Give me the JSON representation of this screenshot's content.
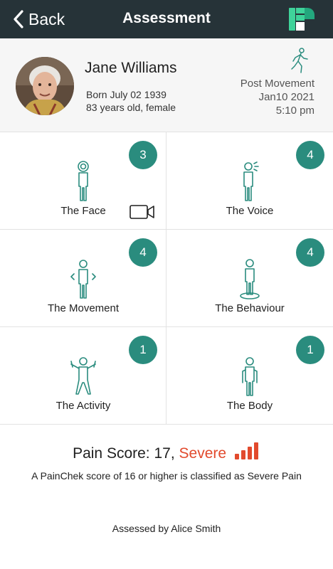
{
  "nav": {
    "back_label": "Back",
    "title": "Assessment"
  },
  "patient": {
    "name": "Jane Williams",
    "born": "Born July 02 1939",
    "age_sex": "83 years old, female",
    "assessment_type": "Post Movement",
    "date": "Jan10 2021",
    "time": "5:10 pm"
  },
  "domains": [
    {
      "label": "The Face",
      "score": "3",
      "icon": "face-person-icon"
    },
    {
      "label": "The Voice",
      "score": "4",
      "icon": "voice-person-icon"
    },
    {
      "label": "The Movement",
      "score": "4",
      "icon": "movement-person-icon"
    },
    {
      "label": "The Behaviour",
      "score": "4",
      "icon": "behaviour-person-icon"
    },
    {
      "label": "The Activity",
      "score": "1",
      "icon": "activity-person-icon"
    },
    {
      "label": "The Body",
      "score": "1",
      "icon": "body-person-icon"
    }
  ],
  "score": {
    "prefix": "Pain Score: 17,",
    "severity": "Severe",
    "note": "A PainChek score of 16 or higher is classified as Severe Pain"
  },
  "assessed_by": "Assessed by Alice Smith",
  "colors": {
    "navbar": "#263338",
    "accent": "#2a8c7e",
    "severe": "#e24a2d"
  }
}
